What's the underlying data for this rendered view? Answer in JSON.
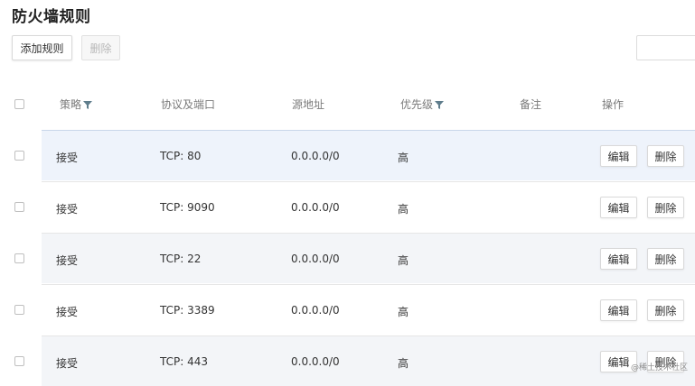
{
  "page": {
    "title": "防火墙规则"
  },
  "toolbar": {
    "add_label": "添加规则",
    "delete_label": "删除"
  },
  "table": {
    "headers": {
      "policy": "策略",
      "protocol_port": "协议及端口",
      "source": "源地址",
      "priority": "优先级",
      "remark": "备注",
      "actions": "操作"
    },
    "rows": [
      {
        "policy": "接受",
        "protocol_port": "TCP: 80",
        "source": "0.0.0.0/0",
        "priority": "高",
        "remark": "",
        "edit_label": "编辑",
        "delete_label": "删除"
      },
      {
        "policy": "接受",
        "protocol_port": "TCP: 9090",
        "source": "0.0.0.0/0",
        "priority": "高",
        "remark": "",
        "edit_label": "编辑",
        "delete_label": "删除"
      },
      {
        "policy": "接受",
        "protocol_port": "TCP: 22",
        "source": "0.0.0.0/0",
        "priority": "高",
        "remark": "",
        "edit_label": "编辑",
        "delete_label": "删除"
      },
      {
        "policy": "接受",
        "protocol_port": "TCP: 3389",
        "source": "0.0.0.0/0",
        "priority": "高",
        "remark": "",
        "edit_label": "编辑",
        "delete_label": "删除"
      },
      {
        "policy": "接受",
        "protocol_port": "TCP: 443",
        "source": "0.0.0.0/0",
        "priority": "高",
        "remark": "",
        "edit_label": "编辑",
        "delete_label": "删除"
      }
    ]
  },
  "watermark": "@稀土技术社区",
  "colors": {
    "row_highlight": "#eef3fb",
    "row_alt": "#f3f5f8",
    "filter_icon": "#5f7d8c"
  }
}
